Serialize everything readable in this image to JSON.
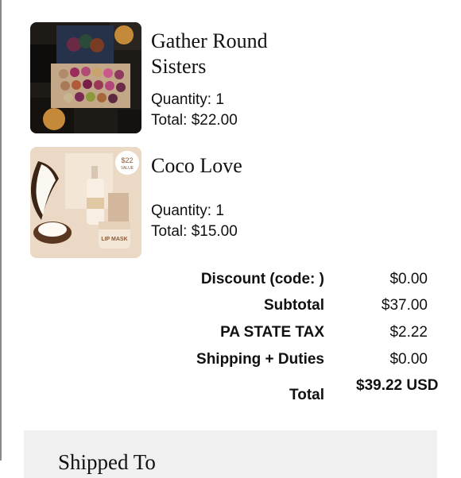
{
  "items": [
    {
      "name": "Gather Round Sisters",
      "quantity": "Quantity: 1",
      "total": "Total: $22.00",
      "image_icon": "eyeshadow-palette"
    },
    {
      "name": "Coco Love",
      "quantity": "Quantity: 1",
      "total": "Total: $15.00",
      "image_icon": "coconut-skincare-set",
      "badge_price": "$22",
      "badge_sub": "VALUE",
      "jar_label": "LIP MASK"
    }
  ],
  "summary": {
    "discount": {
      "label": "Discount (code: )",
      "value": "$0.00"
    },
    "subtotal": {
      "label": "Subtotal",
      "value": "$37.00"
    },
    "tax": {
      "label": "PA STATE TAX",
      "value": "$2.22"
    },
    "shipping": {
      "label": "Shipping + Duties",
      "value": "$0.00"
    },
    "total": {
      "label": "Total",
      "value": "$39.22 USD"
    }
  },
  "shipping_section": {
    "heading": "Shipped To"
  },
  "colors": {
    "text": "#111111",
    "panel_bg": "#f0f0f0",
    "rule": "#8a8a8a"
  }
}
